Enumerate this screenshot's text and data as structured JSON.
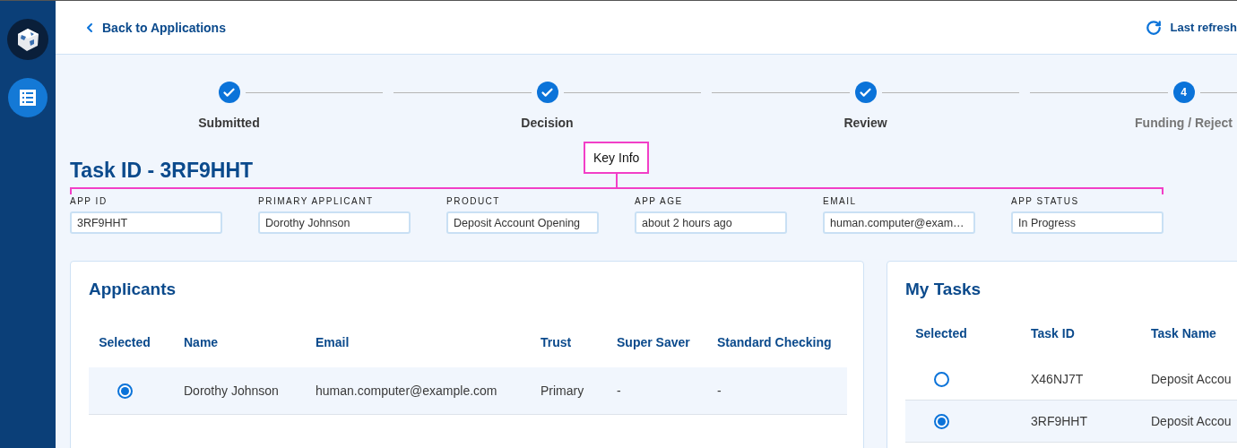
{
  "header": {
    "back_link": "Back to Applications",
    "refresh": "Last refresh"
  },
  "stepper": [
    {
      "label": "Submitted",
      "kind": "done"
    },
    {
      "label": "Decision",
      "kind": "done"
    },
    {
      "label": "Review",
      "kind": "done"
    },
    {
      "label": "Funding / Reject",
      "kind": "current",
      "number": "4"
    }
  ],
  "task_title": "Task ID - 3RF9HHT",
  "annotation": {
    "label": "Key Info"
  },
  "key_info": [
    {
      "label": "APP ID",
      "value": "3RF9HHT"
    },
    {
      "label": "PRIMARY APPLICANT",
      "value": "Dorothy Johnson"
    },
    {
      "label": "PRODUCT",
      "value": "Deposit Account Opening"
    },
    {
      "label": "APP AGE",
      "value": "about 2 hours ago"
    },
    {
      "label": "EMAIL",
      "value": "human.computer@exam…"
    },
    {
      "label": "APP STATUS",
      "value": "In Progress"
    }
  ],
  "applicants": {
    "title": "Applicants",
    "columns": [
      "Selected",
      "Name",
      "Email",
      "Trust",
      "Super Saver",
      "Standard Checking"
    ],
    "rows": [
      {
        "cells": [
          {
            "kind": "radio",
            "selected": true
          },
          {
            "kind": "text",
            "text": "Dorothy Johnson"
          },
          {
            "kind": "text",
            "text": "human.computer@example.com"
          },
          {
            "kind": "text",
            "text": "Primary"
          },
          {
            "kind": "text",
            "text": "-"
          },
          {
            "kind": "text",
            "text": "-"
          }
        ]
      }
    ]
  },
  "tasks": {
    "title": "My Tasks",
    "columns": [
      "Selected",
      "Task ID",
      "Task Name"
    ],
    "rows": [
      {
        "cells": [
          {
            "kind": "radio",
            "selected": false
          },
          {
            "kind": "text",
            "text": "X46NJ7T"
          },
          {
            "kind": "text",
            "text": "Deposit Accou"
          }
        ]
      },
      {
        "cells": [
          {
            "kind": "radio",
            "selected": true
          },
          {
            "kind": "text",
            "text": "3RF9HHT"
          },
          {
            "kind": "text",
            "text": "Deposit Accou"
          }
        ]
      }
    ]
  }
}
